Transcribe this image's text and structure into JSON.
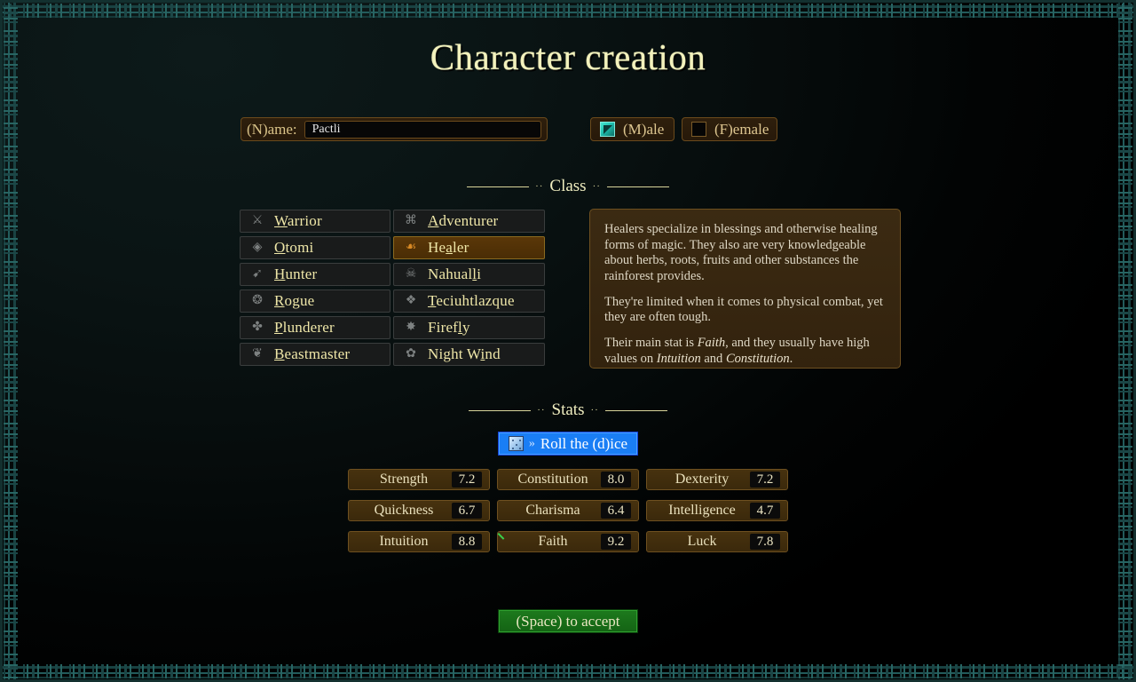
{
  "window": {
    "title": "Character creation"
  },
  "identity": {
    "name_label": "(N)ame:",
    "name_value": "Pactli",
    "name_placeholder": "",
    "male_label": "(M)ale",
    "female_label": "(F)emale",
    "male_checked": true,
    "female_checked": false
  },
  "sections": {
    "class_label": "Class",
    "stats_label": "Stats",
    "divider_dots": "··"
  },
  "classes": {
    "left": [
      {
        "name": "Warrior",
        "hotkey_index": 0,
        "icon": "warrior-shield-icon",
        "selected": false
      },
      {
        "name": "Otomi",
        "hotkey_index": 0,
        "icon": "otomi-helm-icon",
        "selected": false
      },
      {
        "name": "Hunter",
        "hotkey_index": 0,
        "icon": "hunter-bow-icon",
        "selected": false
      },
      {
        "name": "Rogue",
        "hotkey_index": 0,
        "icon": "rogue-dagger-icon",
        "selected": false
      },
      {
        "name": "Plunderer",
        "hotkey_index": 0,
        "icon": "plunderer-axe-icon",
        "selected": false
      },
      {
        "name": "Beastmaster",
        "hotkey_index": 0,
        "icon": "beastmaster-jaguar-icon",
        "selected": false
      }
    ],
    "right": [
      {
        "name": "Adventurer",
        "hotkey_index": 0,
        "icon": "adventurer-pack-icon",
        "selected": false
      },
      {
        "name": "Healer",
        "hotkey_index": 2,
        "icon": "healer-herb-icon",
        "selected": true
      },
      {
        "name": "Nahualli",
        "hotkey_index": 6,
        "icon": "nahualli-skull-icon",
        "selected": false
      },
      {
        "name": "Teciuhtlazque",
        "hotkey_index": 0,
        "icon": "teciuhtlazque-storm-icon",
        "selected": false
      },
      {
        "name": "Firefly",
        "hotkey_index": 5,
        "icon": "firefly-icon",
        "selected": false
      },
      {
        "name": "Night Wind",
        "hotkey_index": 7,
        "icon": "night-wind-icon",
        "selected": false
      }
    ]
  },
  "description": {
    "paragraphs": [
      "Healers specialize in blessings and otherwise healing forms of magic. They also are very knowledgeable about herbs, roots, fruits and other substances the rainforest provides.",
      "They're limited when it comes to physical combat, yet they are often tough."
    ],
    "main_stat_prefix": "Their main stat is ",
    "main_stat": "Faith",
    "main_stat_mid": ", and they usually have high values on ",
    "secondary_stat_1": "Intuition",
    "secondary_stat_join": " and ",
    "secondary_stat_2": "Constitution",
    "main_stat_suffix": "."
  },
  "roll": {
    "icon": "dice-icon",
    "chevron": "»",
    "label": "Roll the (d)ice"
  },
  "stats": [
    {
      "label": "Strength",
      "value": "7.2",
      "main": false
    },
    {
      "label": "Constitution",
      "value": "8.0",
      "main": false
    },
    {
      "label": "Dexterity",
      "value": "7.2",
      "main": false
    },
    {
      "label": "Quickness",
      "value": "6.7",
      "main": false
    },
    {
      "label": "Charisma",
      "value": "6.4",
      "main": false
    },
    {
      "label": "Intelligence",
      "value": "4.7",
      "main": false
    },
    {
      "label": "Intuition",
      "value": "8.8",
      "main": false
    },
    {
      "label": "Faith",
      "value": "9.2",
      "main": true
    },
    {
      "label": "Luck",
      "value": "7.8",
      "main": false
    }
  ],
  "accept": {
    "label": "(Space) to accept"
  },
  "colors": {
    "background": "#0a1414",
    "title": "#f3f2bd",
    "panel_border": "#6b4a1c",
    "selected_class": "#5a3708",
    "roll_button": "#1a7ef5",
    "accept_button": "#1d7a1d",
    "main_stat_marker": "#3ad04a",
    "border_pattern": "#2a6a68",
    "checkbox_checked": "#46e6cf"
  }
}
